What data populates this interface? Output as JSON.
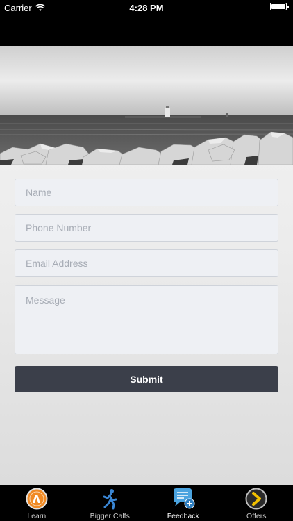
{
  "status_bar": {
    "carrier": "Carrier",
    "time": "4:28 PM",
    "battery_level": 1.0
  },
  "form": {
    "name_placeholder": "Name",
    "phone_placeholder": "Phone Number",
    "email_placeholder": "Email Address",
    "message_placeholder": "Message",
    "submit_label": "Submit"
  },
  "tabs": [
    {
      "label": "Learn",
      "icon": "learn-icon",
      "active": false
    },
    {
      "label": "Bigger Calfs",
      "icon": "runner-icon",
      "active": false
    },
    {
      "label": "Feedback",
      "icon": "feedback-chat-icon",
      "active": true
    },
    {
      "label": "Offers",
      "icon": "chevron-right-icon",
      "active": false
    }
  ],
  "colors": {
    "submit_bg": "#3b3f4a",
    "field_bg": "#eef0f4",
    "tab_bar_bg": "#000000",
    "feedback_icon": "#4aa3df",
    "learn_icon": "#f08a24",
    "offers_icon": "#f2c100"
  }
}
